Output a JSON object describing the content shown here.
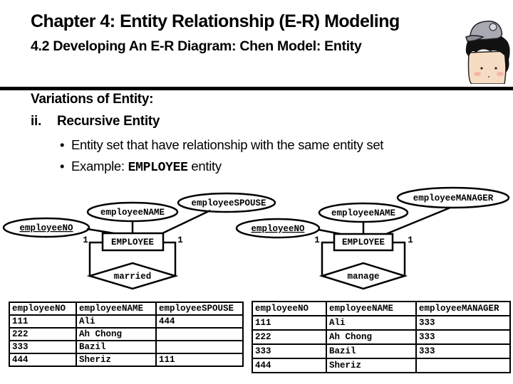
{
  "header": {
    "title": "Chapter 4: Entity Relationship (E-R) Modeling",
    "subtitle": "4.2 Developing An E-R Diagram: Chen Model: Entity",
    "mascot_icon": "cartoon-character-cap-icon"
  },
  "content": {
    "heading": "Variations of Entity:",
    "subheading_number": "ii.",
    "subheading": "Recursive Entity",
    "bullets": [
      {
        "symbol": "•",
        "text": "Entity set that have relationship with the same entity set"
      },
      {
        "symbol": "•",
        "prefix": "Example: ",
        "code": "EMPLOYEE",
        "suffix": " entity"
      }
    ]
  },
  "diagrams": [
    {
      "entity": "EMPLOYEE",
      "attributes": {
        "key": "employeeNO",
        "name": "employeeNAME",
        "recursive": "employeeSPOUSE"
      },
      "relationship": "married",
      "cardinality_left": "1",
      "cardinality_right": "1"
    },
    {
      "entity": "EMPLOYEE",
      "attributes": {
        "key": "employeeNO",
        "name": "employeeNAME",
        "recursive": "employeeMANAGER"
      },
      "relationship": "manage",
      "cardinality_left": "1",
      "cardinality_right": "1"
    }
  ],
  "tables": [
    {
      "headers": [
        "employeeNO",
        "employeeNAME",
        "employeeSPOUSE"
      ],
      "rows": [
        [
          "111",
          "Ali",
          "444"
        ],
        [
          "222",
          "Ah Chong",
          ""
        ],
        [
          "333",
          "Bazil",
          ""
        ],
        [
          "444",
          "Sheriz",
          "111"
        ]
      ]
    },
    {
      "headers": [
        "employeeNO",
        "employeeNAME",
        "employeeMANAGER"
      ],
      "rows": [
        [
          "111",
          "Ali",
          "333"
        ],
        [
          "222",
          "Ah Chong",
          "333"
        ],
        [
          "333",
          "Bazil",
          "333"
        ],
        [
          "444",
          "Sheriz",
          ""
        ]
      ]
    }
  ]
}
